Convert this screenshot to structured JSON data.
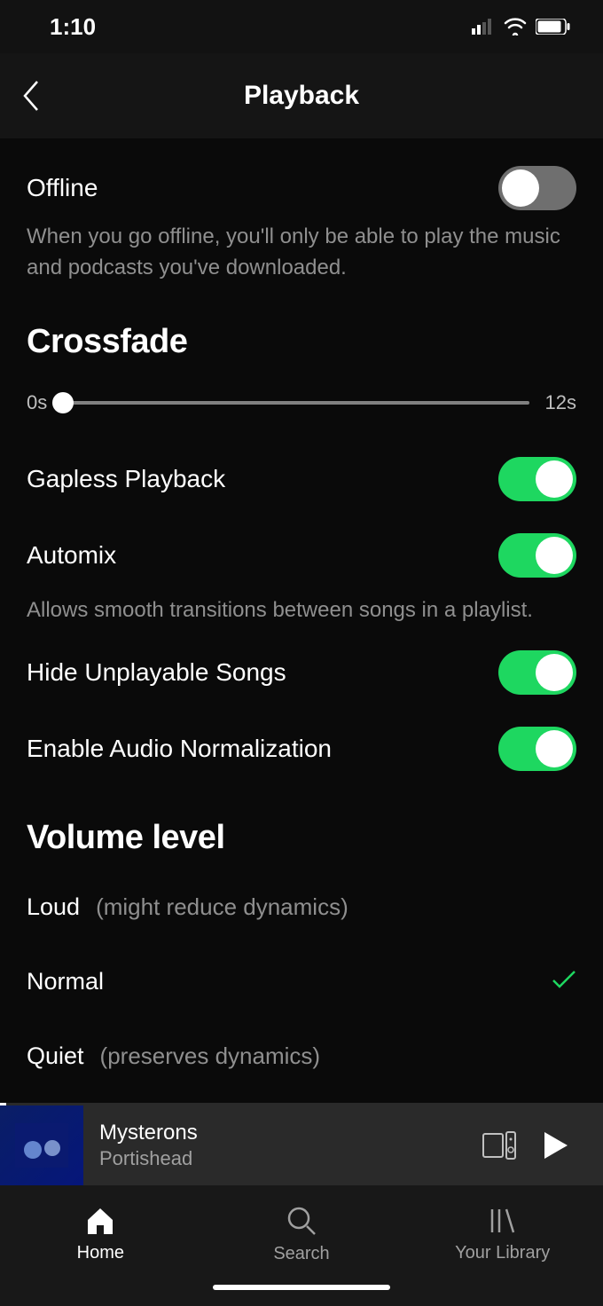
{
  "statusBar": {
    "time": "1:10"
  },
  "header": {
    "title": "Playback"
  },
  "offline": {
    "label": "Offline",
    "enabled": false,
    "desc": "When you go offline, you'll only be able to play the music and podcasts you've downloaded."
  },
  "crossfade": {
    "title": "Crossfade",
    "minLabel": "0s",
    "maxLabel": "12s",
    "value": 0
  },
  "gapless": {
    "label": "Gapless Playback",
    "enabled": true
  },
  "automix": {
    "label": "Automix",
    "enabled": true,
    "desc": "Allows smooth transitions between songs in a playlist."
  },
  "hideUnplayable": {
    "label": "Hide Unplayable Songs",
    "enabled": true
  },
  "audioNorm": {
    "label": "Enable Audio Normalization",
    "enabled": true
  },
  "volume": {
    "title": "Volume level",
    "options": [
      {
        "name": "Loud",
        "hint": "(might reduce dynamics)",
        "selected": false
      },
      {
        "name": "Normal",
        "hint": "",
        "selected": true
      },
      {
        "name": "Quiet",
        "hint": "(preserves dynamics)",
        "selected": false
      }
    ]
  },
  "nowPlaying": {
    "title": "Mysterons",
    "artist": "Portishead"
  },
  "tabs": [
    {
      "label": "Home",
      "active": true
    },
    {
      "label": "Search",
      "active": false
    },
    {
      "label": "Your Library",
      "active": false
    }
  ]
}
